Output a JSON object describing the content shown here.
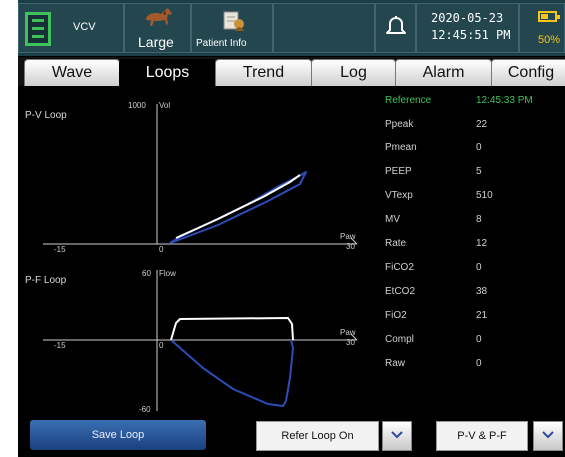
{
  "status": {
    "mode": "VCV",
    "patient_size": "Large",
    "patient_info_label": "Patient Info",
    "date": "2020-05-23",
    "time": "12:45:51 PM",
    "battery_percent": "50%",
    "battery_level": 0.5
  },
  "tabs": [
    "Wave",
    "Loops",
    "Trend",
    "Log",
    "Alarm",
    "Config"
  ],
  "active_tab": "Loops",
  "loops": {
    "pv": {
      "title": "P-V Loop",
      "y_top": "1000",
      "y_name": "Vol",
      "x_min": "-15",
      "x_zero": "0",
      "x_max": "30",
      "x_name": "Paw"
    },
    "pf": {
      "title": "P-F Loop",
      "y_top": "60",
      "y_name": "Flow",
      "y_bottom": "-60",
      "x_min": "-15",
      "x_zero": "0",
      "x_max": "30",
      "x_name": "Paw"
    }
  },
  "reference": {
    "label": "Reference",
    "time": "12:45:33 PM"
  },
  "params": [
    {
      "name": "Ppeak",
      "value": "22"
    },
    {
      "name": "Pmean",
      "value": "0"
    },
    {
      "name": "PEEP",
      "value": "5"
    },
    {
      "name": "VTexp",
      "value": "510"
    },
    {
      "name": "MV",
      "value": "8"
    },
    {
      "name": "Rate",
      "value": "12"
    },
    {
      "name": "FiCO2",
      "value": "0"
    },
    {
      "name": "EtCO2",
      "value": "38"
    },
    {
      "name": "FiO2",
      "value": "21"
    },
    {
      "name": "Compl",
      "value": "0"
    },
    {
      "name": "Raw",
      "value": "0"
    }
  ],
  "bottom": {
    "save_loop": "Save Loop",
    "refer_loop": "Refer Loop On",
    "loop_select": "P-V & P-F"
  },
  "colors": {
    "accent_green": "#3fc15c",
    "loop_blue": "#2c4db8",
    "loop_white": "#ffffff",
    "battery_yellow": "#f5c518"
  }
}
